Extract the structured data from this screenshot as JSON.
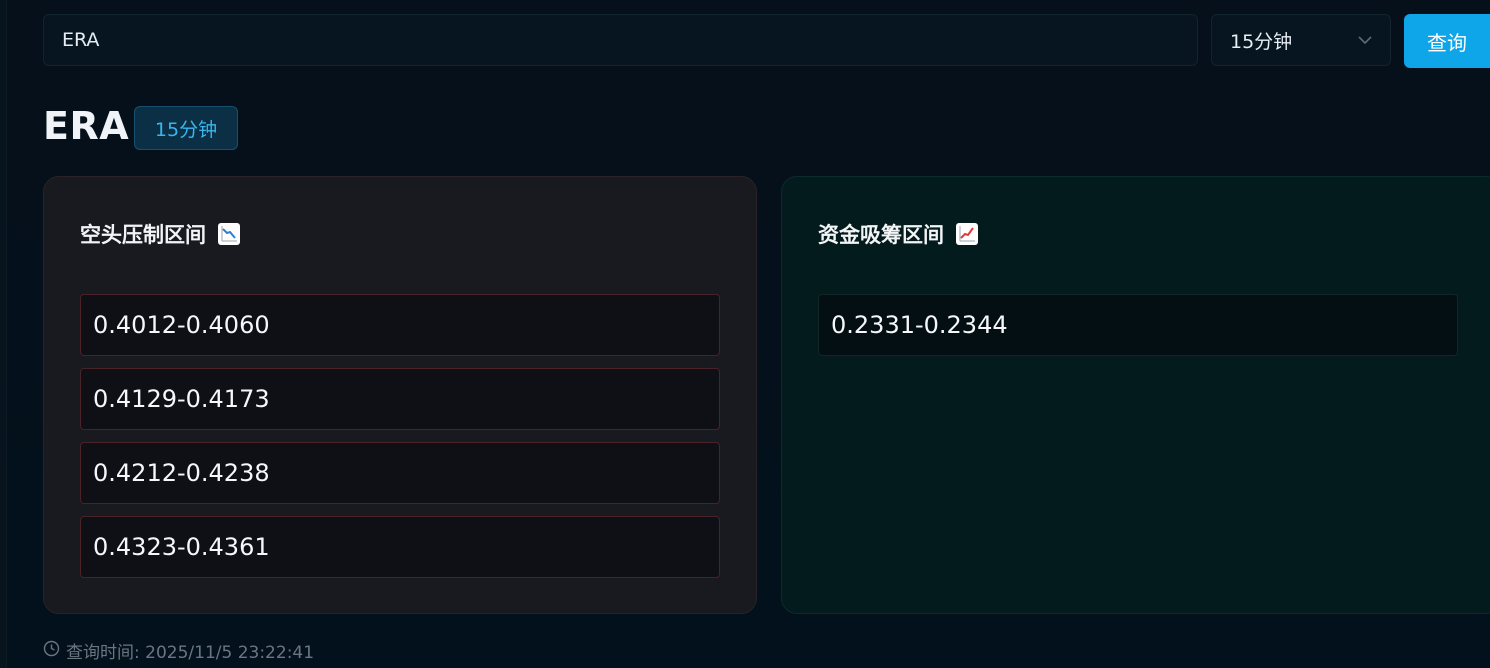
{
  "search": {
    "value": "ERA"
  },
  "interval_select": {
    "selected": "15分钟"
  },
  "query_button": {
    "label": "查询"
  },
  "header": {
    "symbol": "ERA",
    "interval_badge": "15分钟"
  },
  "bear_card": {
    "title": "空头压制区间",
    "icon": "chart-decreasing-icon",
    "ranges": [
      "0.4012-0.4060",
      "0.4129-0.4173",
      "0.4212-0.4238",
      "0.4323-0.4361"
    ]
  },
  "bull_card": {
    "title": "资金吸筹区间",
    "icon": "chart-increasing-icon",
    "ranges": [
      "0.2331-0.2344"
    ]
  },
  "footer": {
    "query_time": "查询时间: 2025/11/5 23:22:41"
  },
  "colors": {
    "accent": "#0ea5e9",
    "bear_border": "#4a2228",
    "bull_bg": "#041b1e"
  }
}
